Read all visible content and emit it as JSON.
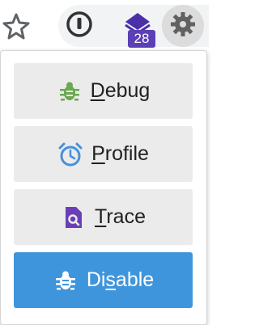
{
  "toolbar": {
    "bookmark_icon": "star-icon",
    "extensions": [
      {
        "name": "1password",
        "icon": "keyhole-icon"
      },
      {
        "name": "stack",
        "icon": "stack-icon",
        "badge": "28"
      },
      {
        "name": "debug-extension",
        "icon": "gear-bug-icon"
      }
    ]
  },
  "menu": {
    "items": [
      {
        "pre": "",
        "acc": "D",
        "post": "ebug",
        "icon": "bug-icon",
        "icon_color": "#6aa84f"
      },
      {
        "pre": "",
        "acc": "P",
        "post": "rofile",
        "icon": "alarm-clock-icon",
        "icon_color": "#4a90d9"
      },
      {
        "pre": "",
        "acc": "T",
        "post": "race",
        "icon": "document-search-icon",
        "icon_color": "#6a3fb5"
      },
      {
        "pre": "Di",
        "acc": "s",
        "post": "able",
        "icon": "bug-icon",
        "icon_color": "#ffffff"
      }
    ],
    "disable_bg": "#3f95dc"
  }
}
